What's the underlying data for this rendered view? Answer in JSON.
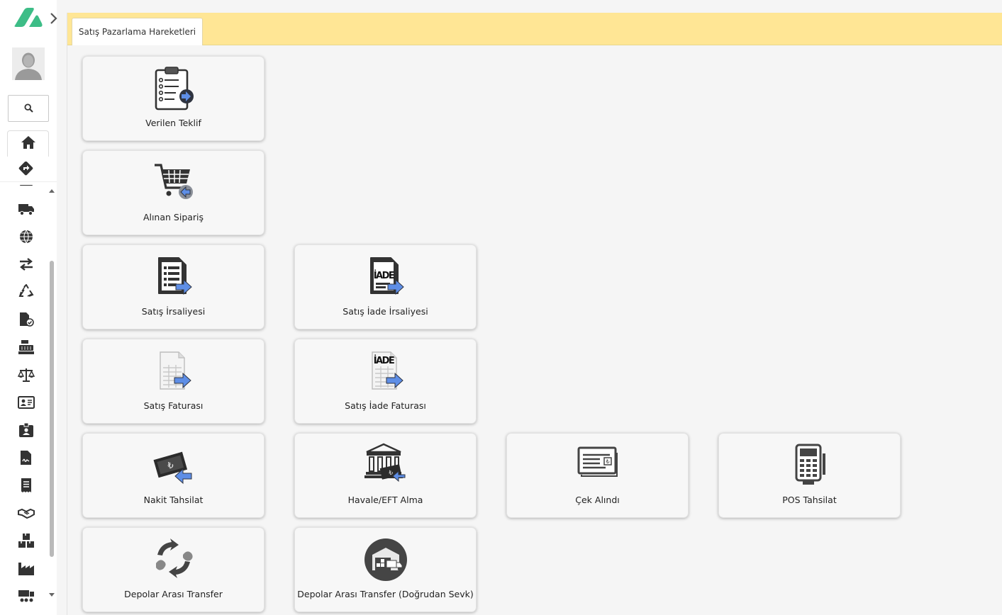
{
  "colors": {
    "accent": "#3dbd87",
    "tabbar": "#ffe695",
    "arrow_blue": "#5e8ee6",
    "icon_dark": "#333333"
  },
  "sidebar": {
    "logo_icon": "brand-logo-icon",
    "expand_icon": "chevron-right-icon",
    "avatar_icon": "user-avatar-icon",
    "search_icon": "search-icon",
    "home_icon": "home-icon",
    "route_icon": "route-sign-icon",
    "menu_icons": [
      "truck-icon",
      "globe-icon",
      "transfer-arrows-icon",
      "recycle-icon",
      "file-check-icon",
      "cash-register-icon",
      "balance-scale-icon",
      "id-card-icon",
      "id-badge-icon",
      "file-signature-icon",
      "receipt-icon",
      "handshake-icon",
      "boxes-icon",
      "factory-icon",
      "shipping-icon"
    ]
  },
  "tabs": [
    {
      "label": "Satış Pazarlama Hareketleri"
    }
  ],
  "cards": [
    {
      "label": "Verilen Teklif",
      "icon": "clipboard-checklist-icon"
    },
    {
      "label": "Alınan Sipariş",
      "icon": "shopping-cart-return-icon"
    },
    {
      "label": "Satış İrsaliyesi",
      "icon": "dispatch-document-icon"
    },
    {
      "label": "Satış İade İrsaliyesi",
      "icon": "return-dispatch-document-icon",
      "icon_text": "İADE"
    },
    {
      "label": "Satış Faturası",
      "icon": "invoice-icon"
    },
    {
      "label": "Satış İade Faturası",
      "icon": "return-invoice-icon",
      "icon_text": "İADE"
    },
    {
      "label": "Nakit Tahsilat",
      "icon": "cash-collection-icon"
    },
    {
      "label": "Havale/EFT Alma",
      "icon": "bank-transfer-icon"
    },
    {
      "label": "Çek Alındı",
      "icon": "cheque-icon"
    },
    {
      "label": "POS Tahsilat",
      "icon": "pos-terminal-icon"
    },
    {
      "label": "Depolar Arası Transfer",
      "icon": "warehouse-transfer-icon"
    },
    {
      "label": "Depolar Arası Transfer (Doğrudan Sevk)",
      "icon": "direct-shipment-warehouse-icon"
    }
  ]
}
